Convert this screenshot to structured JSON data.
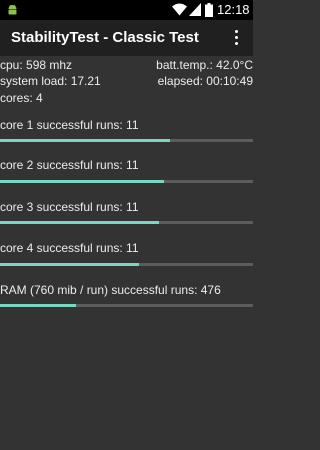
{
  "status_bar": {
    "time": "12:18",
    "icons": [
      "android-icon",
      "wifi-icon",
      "cell-signal-icon",
      "battery-icon"
    ]
  },
  "app_bar": {
    "title": "StabilityTest - Classic Test",
    "menu_icon": "overflow-menu-icon"
  },
  "info": {
    "cpu": "cpu: 598 mhz",
    "batt_temp": "batt.temp.: 42.0°C",
    "system_load": "system load: 17.21",
    "elapsed": "elapsed: 00:10:49",
    "cores": "cores: 4"
  },
  "tests": [
    {
      "label": "core 1 successful runs: 11",
      "progress": 0.67
    },
    {
      "label": "core 2 successful runs: 11",
      "progress": 0.65
    },
    {
      "label": "core 3 successful runs: 11",
      "progress": 0.63
    },
    {
      "label": "core 4 successful runs: 11",
      "progress": 0.55
    },
    {
      "label": "RAM (760 mib / run) successful runs: 476",
      "progress": 0.3
    }
  ],
  "colors": {
    "background": "#333333",
    "app_bar": "#202020",
    "progress_fill": "#79d6c3",
    "progress_track": "#5c5c5c"
  }
}
